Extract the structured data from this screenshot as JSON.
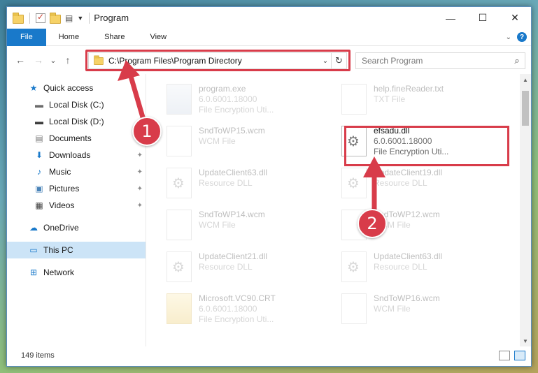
{
  "window": {
    "title": "Program",
    "controls": {
      "minimize": "—",
      "maximize": "☐",
      "close": "✕"
    }
  },
  "ribbon": {
    "tabs": [
      "File",
      "Home",
      "Share",
      "View"
    ],
    "help": "?"
  },
  "nav": {
    "back": "←",
    "forward": "→",
    "recent": "⌄",
    "up": "↑",
    "address_path": "C:\\Program Files\\Program Directory",
    "address_dropdown": "⌄",
    "refresh": "↻",
    "search_placeholder": "Search Program",
    "search_icon_glyph": "⌕"
  },
  "sidebar": {
    "items": [
      {
        "label": "Quick access",
        "icon": "star-icon",
        "glyph": "★",
        "color": "#1979ca"
      },
      {
        "label": "Local Disk (C:)",
        "icon": "drive-icon",
        "glyph": "▬",
        "color": "#6b6b6b"
      },
      {
        "label": "Local Disk (D:)",
        "icon": "drive-icon",
        "glyph": "▬",
        "color": "#3d3d3d"
      },
      {
        "label": "Documents",
        "icon": "documents-icon",
        "glyph": "▤",
        "color": "#7a7a7a"
      },
      {
        "label": "Downloads",
        "icon": "download-icon",
        "glyph": "⬇",
        "color": "#1979ca",
        "pin": "📌"
      },
      {
        "label": "Music",
        "icon": "music-icon",
        "glyph": "♪",
        "color": "#1979ca",
        "pin": "📌"
      },
      {
        "label": "Pictures",
        "icon": "pictures-icon",
        "glyph": "▣",
        "color": "#4b84b8",
        "pin": "📌"
      },
      {
        "label": "Videos",
        "icon": "videos-icon",
        "glyph": "▦",
        "color": "#444444",
        "pin": "📌"
      },
      {
        "label": "OneDrive",
        "icon": "cloud-icon",
        "glyph": "☁",
        "color": "#1979ca"
      },
      {
        "label": "This PC",
        "icon": "computer-icon",
        "glyph": "▭",
        "color": "#1979ca"
      },
      {
        "label": "Network",
        "icon": "network-icon",
        "glyph": "⊞",
        "color": "#1979ca"
      }
    ]
  },
  "files": {
    "left": [
      {
        "name": "program.exe",
        "line2": "6.0.6001.18000",
        "line3": "File Encryption Uti..."
      },
      {
        "name": "SndToWP15.wcm",
        "line2": "WCM File",
        "line3": ""
      },
      {
        "name": "UpdateClient63.dll",
        "line2": "Resource DLL",
        "line3": ""
      },
      {
        "name": "SndToWP14.wcm",
        "line2": "WCM File",
        "line3": ""
      },
      {
        "name": "UpdateClient21.dll",
        "line2": "Resource DLL",
        "line3": ""
      },
      {
        "name": "Microsoft.VC90.CRT",
        "line2": "6.0.6001.18000",
        "line3": "File Encryption Uti..."
      }
    ],
    "right": [
      {
        "name": "help.fineReader.txt",
        "line2": "TXT File",
        "line3": ""
      },
      {
        "name": "efsadu.dll",
        "line2": "6.0.6001.18000",
        "line3": "File Encryption Uti..."
      },
      {
        "name": "UpdateClient19.dll",
        "line2": "Resource DLL",
        "line3": ""
      },
      {
        "name": "SndToWP12.wcm",
        "line2": "WCM File",
        "line3": ""
      },
      {
        "name": "UpdateClient63.dll",
        "line2": "Resource DLL",
        "line3": ""
      },
      {
        "name": "SndToWP16.wcm",
        "line2": "WCM File",
        "line3": ""
      }
    ]
  },
  "status": {
    "item_count": "149 items"
  },
  "annotations": {
    "callout_1": "1",
    "callout_2": "2",
    "color": "#d83c4a"
  }
}
